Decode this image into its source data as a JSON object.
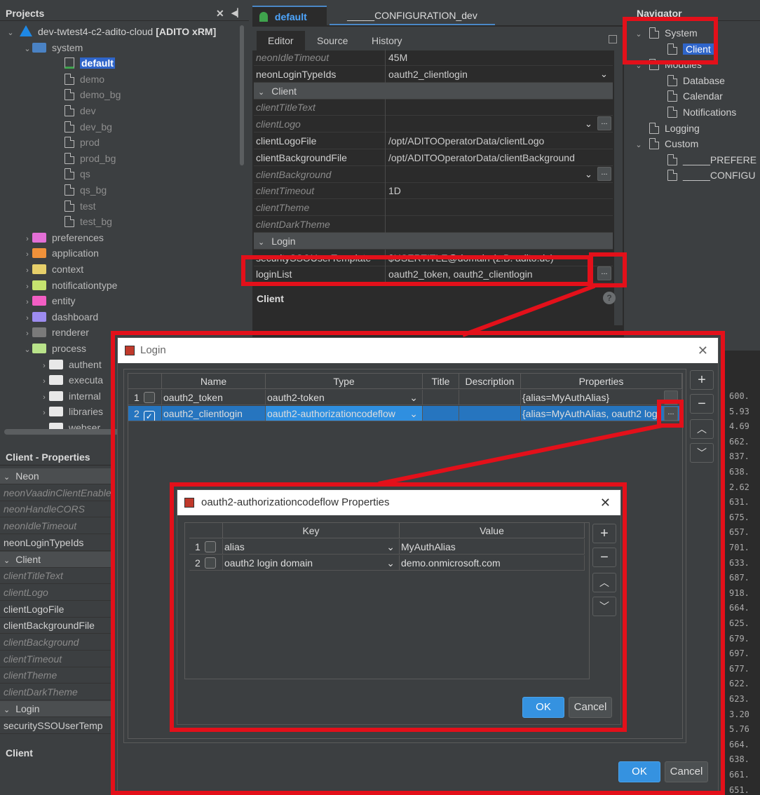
{
  "projects": {
    "title": "Projects",
    "root": {
      "name": "dev-twtest4-c2-adito-cloud",
      "suffix": "[ADITO xRM]"
    },
    "system": "system",
    "aliases": [
      "default",
      "demo",
      "demo_bg",
      "dev",
      "dev_bg",
      "prod",
      "prod_bg",
      "qs",
      "qs_bg",
      "test",
      "test_bg"
    ],
    "folders": [
      {
        "label": "preferences",
        "color": "#e36fd6"
      },
      {
        "label": "application",
        "color": "#f0913a"
      },
      {
        "label": "context",
        "color": "#e6cf6a"
      },
      {
        "label": "notificationtype",
        "color": "#c5e36f"
      },
      {
        "label": "entity",
        "color": "#f25ec3"
      },
      {
        "label": "dashboard",
        "color": "#9d8cf0"
      },
      {
        "label": "renderer",
        "color": "#7a7a7a"
      },
      {
        "label": "process",
        "color": "#b9e38a"
      }
    ],
    "process_children": [
      "authent",
      "executa",
      "internal",
      "libraries",
      "webser"
    ]
  },
  "props_panel": {
    "title": "Client - Properties",
    "rows": [
      {
        "t": "sec",
        "label": "Neon"
      },
      {
        "t": "it",
        "label": "neonVaadinClientEnable"
      },
      {
        "t": "it",
        "label": "neonHandleCORS"
      },
      {
        "t": "it",
        "label": "neonIdleTimeout"
      },
      {
        "t": "n",
        "label": "neonLoginTypeIds"
      },
      {
        "t": "sec",
        "label": "Client"
      },
      {
        "t": "it",
        "label": "clientTitleText"
      },
      {
        "t": "it",
        "label": "clientLogo"
      },
      {
        "t": "n",
        "label": "clientLogoFile"
      },
      {
        "t": "n",
        "label": "clientBackgroundFile"
      },
      {
        "t": "it",
        "label": "clientBackground"
      },
      {
        "t": "it",
        "label": "clientTimeout"
      },
      {
        "t": "it",
        "label": "clientTheme"
      },
      {
        "t": "it",
        "label": "clientDarkTheme"
      },
      {
        "t": "sec",
        "label": "Login"
      },
      {
        "t": "n",
        "label": "securitySSOUserTemp"
      }
    ],
    "footer": "Client"
  },
  "editor": {
    "tabs": [
      "default",
      "_____CONFIGURATION_dev"
    ],
    "subtabs": [
      "Editor",
      "Source",
      "History"
    ],
    "rows": [
      {
        "t": "it",
        "k": "neonIdleTimeout",
        "v": "45M"
      },
      {
        "t": "n",
        "k": "neonLoginTypeIds",
        "v": "oauth2_clientlogin",
        "dd": true
      },
      {
        "t": "sec",
        "k": "Client"
      },
      {
        "t": "it",
        "k": "clientTitleText",
        "v": ""
      },
      {
        "t": "it",
        "k": "clientLogo",
        "v": "",
        "dd": true,
        "btn": true
      },
      {
        "t": "n",
        "k": "clientLogoFile",
        "v": "/opt/ADITOOperatorData/clientLogo"
      },
      {
        "t": "n",
        "k": "clientBackgroundFile",
        "v": "/opt/ADITOOperatorData/clientBackground"
      },
      {
        "t": "it",
        "k": "clientBackground",
        "v": "",
        "dd": true,
        "btn": true
      },
      {
        "t": "it",
        "k": "clientTimeout",
        "v": "1D"
      },
      {
        "t": "it",
        "k": "clientTheme",
        "v": ""
      },
      {
        "t": "it",
        "k": "clientDarkTheme",
        "v": ""
      },
      {
        "t": "sec",
        "k": "Login"
      },
      {
        "t": "n",
        "k": "securitySSOUserTemplate",
        "v": "$USERTITLE@domain (z.B. adito.de)"
      },
      {
        "t": "n",
        "k": "loginList",
        "v": "oauth2_token, oauth2_clientlogin",
        "btn": true
      }
    ],
    "footer": "Client"
  },
  "navigator": {
    "title": "Navigator",
    "items": [
      {
        "label": "System",
        "level": 0,
        "tog": "v"
      },
      {
        "label": "Client",
        "level": 1,
        "sel": true
      },
      {
        "label": "Modules",
        "level": 0,
        "tog": "v"
      },
      {
        "label": "Database",
        "level": 1
      },
      {
        "label": "Calendar",
        "level": 1
      },
      {
        "label": "Notifications",
        "level": 1
      },
      {
        "label": "Logging",
        "level": 0
      },
      {
        "label": "Custom",
        "level": 0,
        "tog": "v"
      },
      {
        "label": "_____PREFERE",
        "level": 1
      },
      {
        "label": "_____CONFIGU",
        "level": 1
      }
    ]
  },
  "login_dialog": {
    "title": "Login",
    "columns": [
      "Name",
      "Type",
      "Title",
      "Description",
      "Properties"
    ],
    "rows": [
      {
        "num": "1",
        "checked": false,
        "name": "oauth2_token",
        "type": "oauth2-token",
        "title": "",
        "description": "",
        "properties": "{alias=MyAuthAlias}"
      },
      {
        "num": "2",
        "checked": true,
        "name": "oauth2_clientlogin",
        "type": "oauth2-authorizationcodeflow",
        "title": "",
        "description": "",
        "properties": "{alias=MyAuthAlias, oauth2 log"
      }
    ],
    "ok": "OK",
    "cancel": "Cancel"
  },
  "props_dialog": {
    "title": "oauth2-authorizationcodeflow Properties",
    "columns": [
      "Key",
      "Value"
    ],
    "rows": [
      {
        "num": "1",
        "key": "alias",
        "value": "MyAuthAlias"
      },
      {
        "num": "2",
        "key": "oauth2 login domain",
        "value": "demo.onmicrosoft.com"
      }
    ],
    "ok": "OK",
    "cancel": "Cancel"
  },
  "side_numbers": [
    "600.",
    "5.93",
    "4.69",
    "662.",
    "837.",
    "638.",
    "2.62",
    "631.",
    "675.",
    "657.",
    "701.",
    "633.",
    "687.",
    "918.",
    "664.",
    "625.",
    "679.",
    "697.",
    "677.",
    "622.",
    "623.",
    "3.20",
    "5.76",
    "664.",
    "638.",
    "661.",
    "651."
  ],
  "colors": {
    "accent": "#2f65ca",
    "highlight_red": "#e3101a",
    "ok_blue": "#3592e0"
  }
}
